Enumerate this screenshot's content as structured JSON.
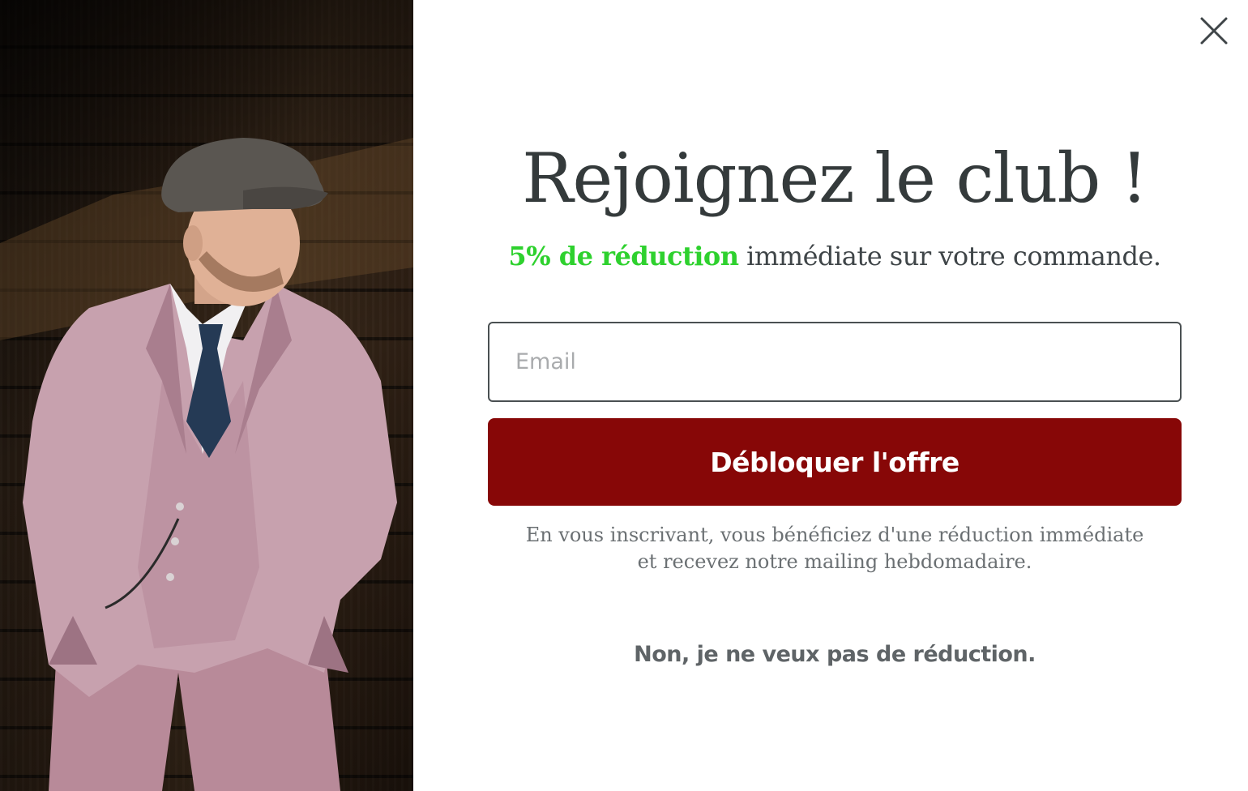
{
  "popup": {
    "title": "Rejoignez le club !",
    "subtitle_highlight": "5% de réduction",
    "subtitle_rest": " immédiate sur votre commande.",
    "email_placeholder": "Email",
    "email_value": "",
    "submit_label": "Débloquer l'offre",
    "disclaimer_line1": "En vous inscrivant, vous bénéficiez d'une réduction immédiate",
    "disclaimer_line2": "et recevez notre mailing hebdomadaire.",
    "decline_label": "Non, je ne veux pas de réduction."
  },
  "icons": {
    "close": "close-icon"
  },
  "colors": {
    "highlight": "#2ed12e",
    "button": "#870707",
    "title": "#343a3b",
    "text_muted": "#6b7073"
  }
}
